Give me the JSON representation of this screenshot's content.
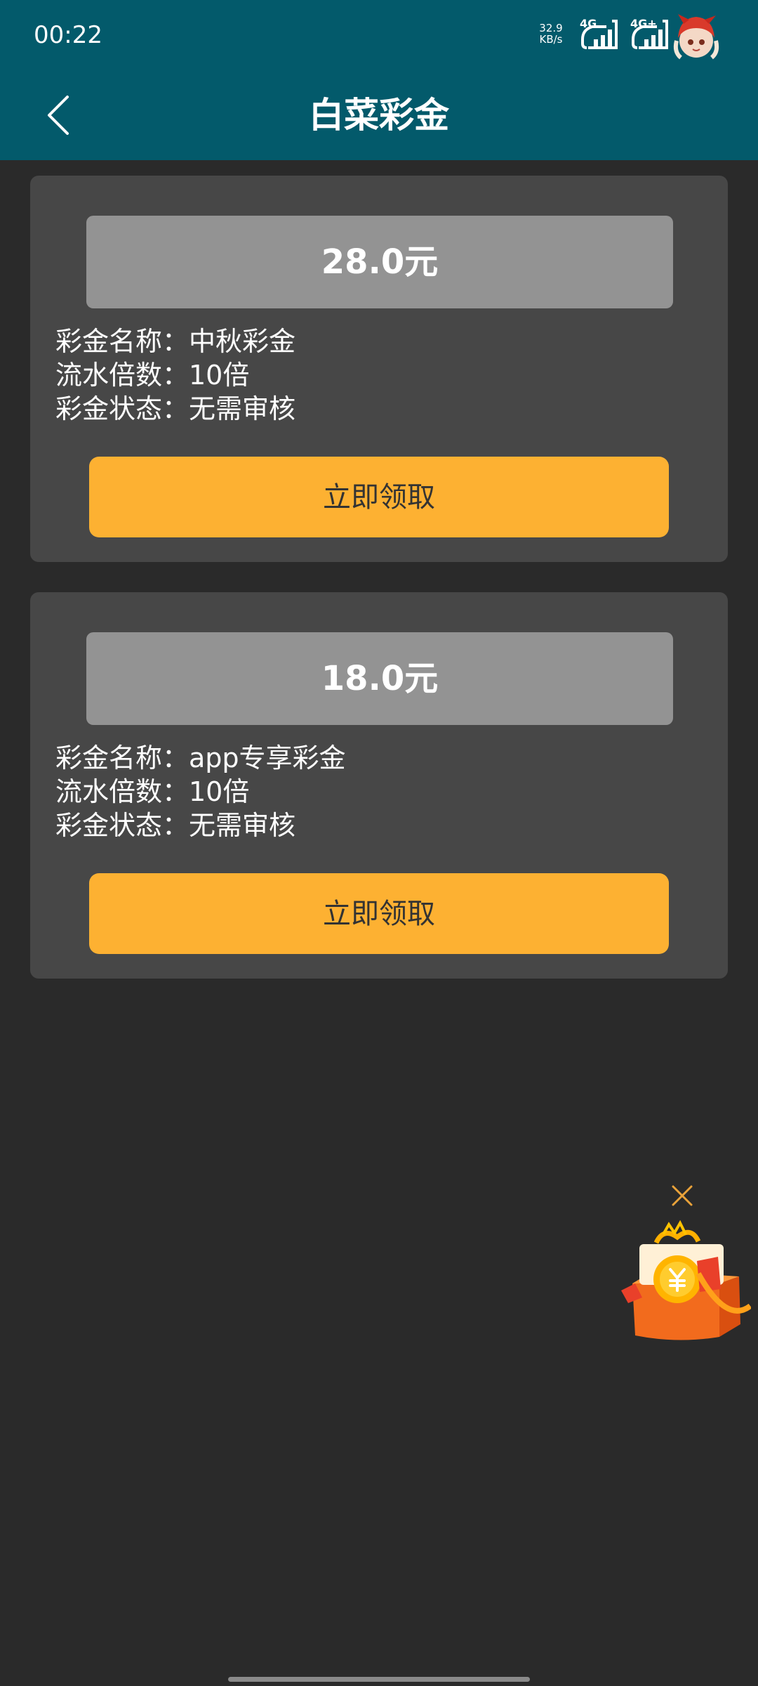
{
  "status_bar": {
    "time": "00:22",
    "net_speed_value": "32.9",
    "net_speed_unit": "KB/s",
    "signal_1": "4G",
    "signal_2": "4G+"
  },
  "header": {
    "title": "白菜彩金"
  },
  "cards": [
    {
      "amount": "28.0元",
      "name_line": "彩金名称：中秋彩金",
      "multiplier_line": "流水倍数：10倍",
      "status_line": "彩金状态：无需审核",
      "button_label": "立即领取"
    },
    {
      "amount": "18.0元",
      "name_line": "彩金名称：app专享彩金",
      "multiplier_line": "流水倍数：10倍",
      "status_line": "彩金状态：无需审核",
      "button_label": "立即领取"
    }
  ],
  "icons": {
    "back": "chevron-left-icon",
    "close": "close-icon",
    "gift": "gift-box-icon"
  },
  "colors": {
    "header_bg": "#035a6b",
    "page_bg": "#2a2a2a",
    "card_bg": "#474747",
    "amount_bg": "#939393",
    "button_bg": "#fdb132"
  }
}
